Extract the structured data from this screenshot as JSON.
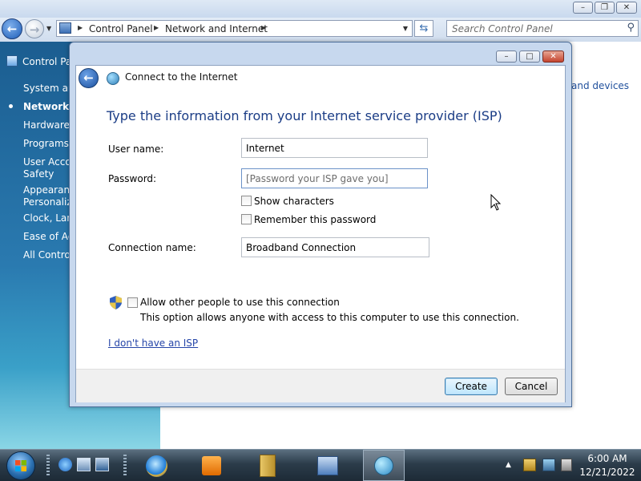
{
  "control_panel": {
    "breadcrumb": [
      "Control Panel",
      "Network and Internet"
    ],
    "search_placeholder": "Search Control Panel",
    "sidebar": {
      "home": "Control Pane",
      "items": [
        {
          "label": "System and"
        },
        {
          "label": "Network a",
          "selected": true
        },
        {
          "label": "Hardware a"
        },
        {
          "label": "Programs"
        },
        {
          "label": "User Accou\nSafety"
        },
        {
          "label": "Appearanc\nPersonaliza"
        },
        {
          "label": "Clock, Lang"
        },
        {
          "label": "Ease of Acc"
        },
        {
          "label": "All Control"
        }
      ]
    },
    "content_right_text": "and devices"
  },
  "dialog": {
    "title": "Connect to the Internet",
    "heading": "Type the information from your Internet service provider (ISP)",
    "username_label": "User name:",
    "username_value": "Internet",
    "password_label": "Password:",
    "password_placeholder": "[Password your ISP gave you]",
    "show_characters": {
      "label": "Show characters",
      "checked": false
    },
    "remember_password": {
      "label": "Remember this password",
      "checked": false
    },
    "connection_name_label": "Connection name:",
    "connection_name_value": "Broadband Connection",
    "allow_others": {
      "label": "Allow other people to use this connection",
      "checked": false
    },
    "allow_others_description": "This option allows anyone with access to this computer to use this connection.",
    "no_isp_link": "I don't have an ISP",
    "create_button": "Create",
    "cancel_button": "Cancel"
  },
  "taskbar": {
    "clock_time": "6:00 AM",
    "clock_date": "12/21/2022"
  },
  "colors": {
    "heading_blue": "#1b3d86",
    "link_blue": "#2545a8",
    "sidebar_blue": "#1b5d90"
  }
}
